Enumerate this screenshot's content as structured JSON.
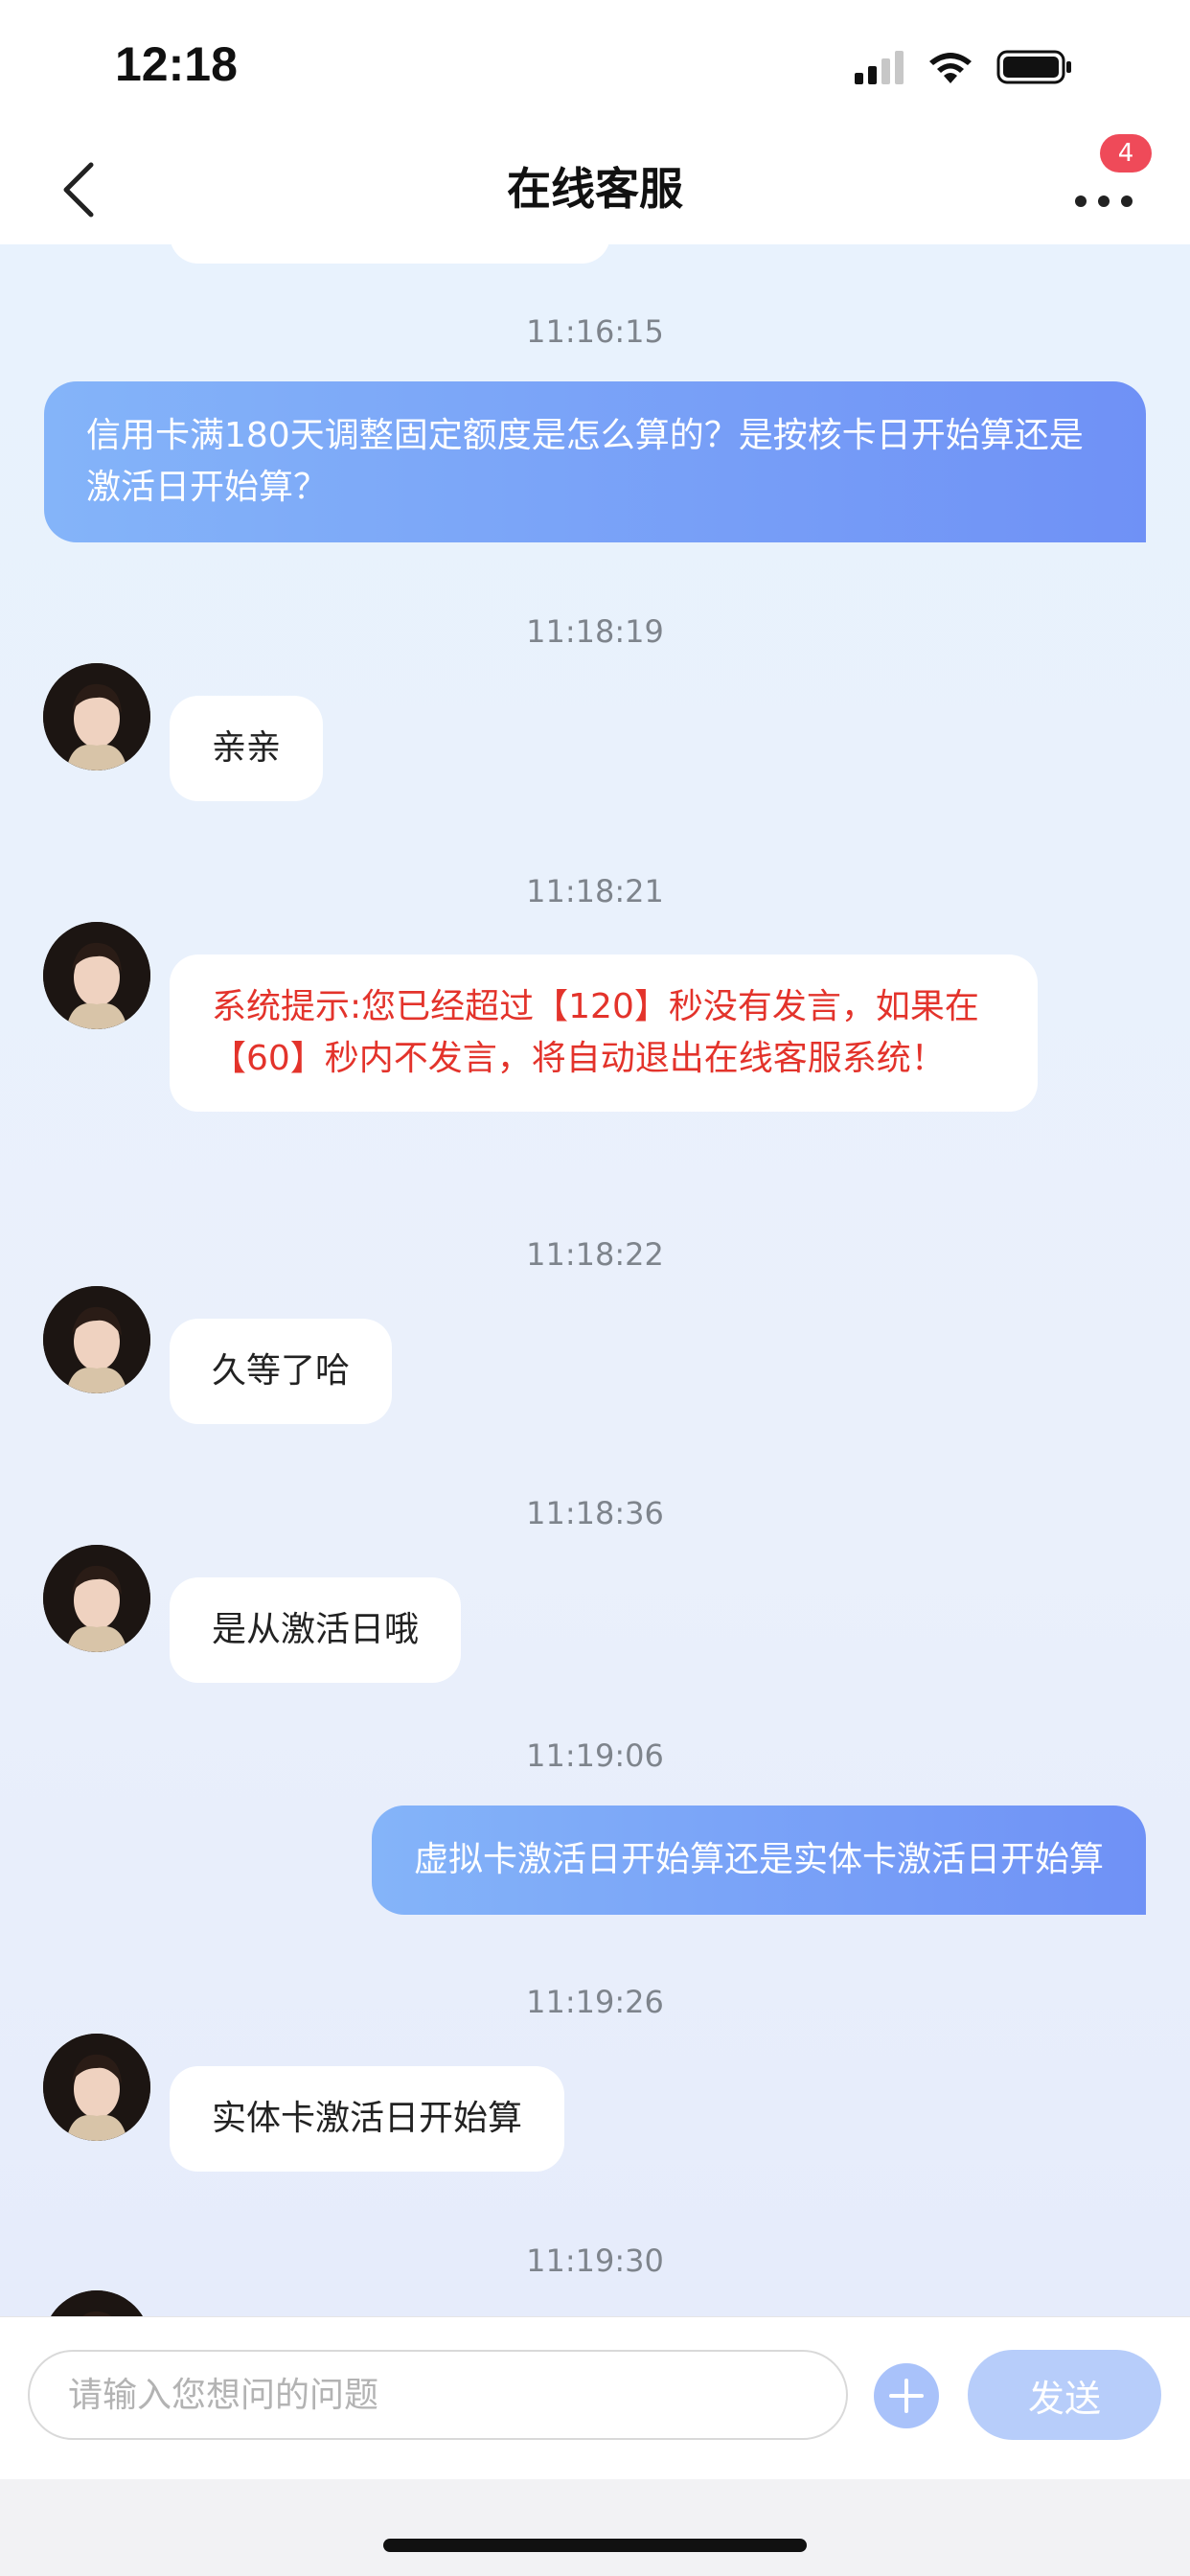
{
  "status_bar": {
    "time": "12:18"
  },
  "nav": {
    "title": "在线客服",
    "badge_count": "4"
  },
  "messages": [
    {
      "timestamp": "11:16:15",
      "outgoing": "信用卡满180天调整固定额度是怎么算的？是按核卡日开始算还是激活日开始算？"
    },
    {
      "timestamp": "11:18:19",
      "incoming": "亲亲"
    },
    {
      "timestamp": "11:18:21",
      "system": "系统提示:您已经超过【120】秒没有发言，如果在【60】秒内不发言，将自动退出在线客服系统！"
    },
    {
      "timestamp": "11:18:22",
      "incoming": "久等了哈"
    },
    {
      "timestamp": "11:18:36",
      "incoming": "是从激活日哦"
    },
    {
      "timestamp": "11:19:06",
      "outgoing": "虚拟卡激活日开始算还是实体卡激活日开始算"
    },
    {
      "timestamp": "11:19:26",
      "incoming": "实体卡激活日开始算"
    },
    {
      "timestamp": "11:19:30"
    }
  ],
  "input": {
    "placeholder": "请输入您想问的问题",
    "value": ""
  },
  "send_label": "发送",
  "colors": {
    "accent": "#6f91f6",
    "badge": "#ef4a59",
    "system_text": "#e3332b"
  }
}
